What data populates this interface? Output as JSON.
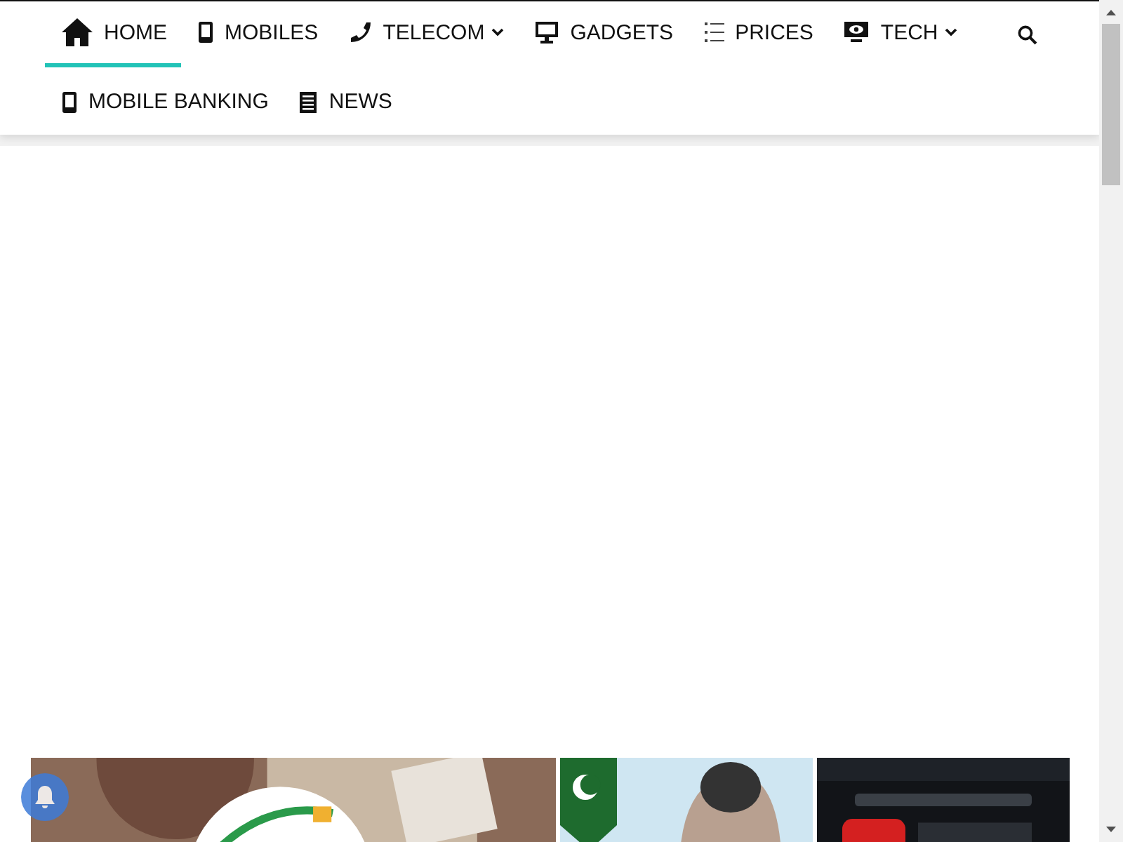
{
  "nav": {
    "rows": [
      [
        {
          "label": "HOME",
          "dropdown": false,
          "selected": true
        },
        {
          "label": "MOBILES",
          "dropdown": false,
          "selected": false
        },
        {
          "label": "TELECOM",
          "dropdown": true,
          "selected": false
        },
        {
          "label": "GADGETS",
          "dropdown": false,
          "selected": false
        },
        {
          "label": "PRICES",
          "dropdown": false,
          "selected": false
        },
        {
          "label": "TECH",
          "dropdown": true,
          "selected": false
        }
      ],
      [
        {
          "label": "MOBILE BANKING",
          "dropdown": false,
          "selected": false
        },
        {
          "label": "NEWS",
          "dropdown": false,
          "selected": false
        }
      ]
    ]
  }
}
